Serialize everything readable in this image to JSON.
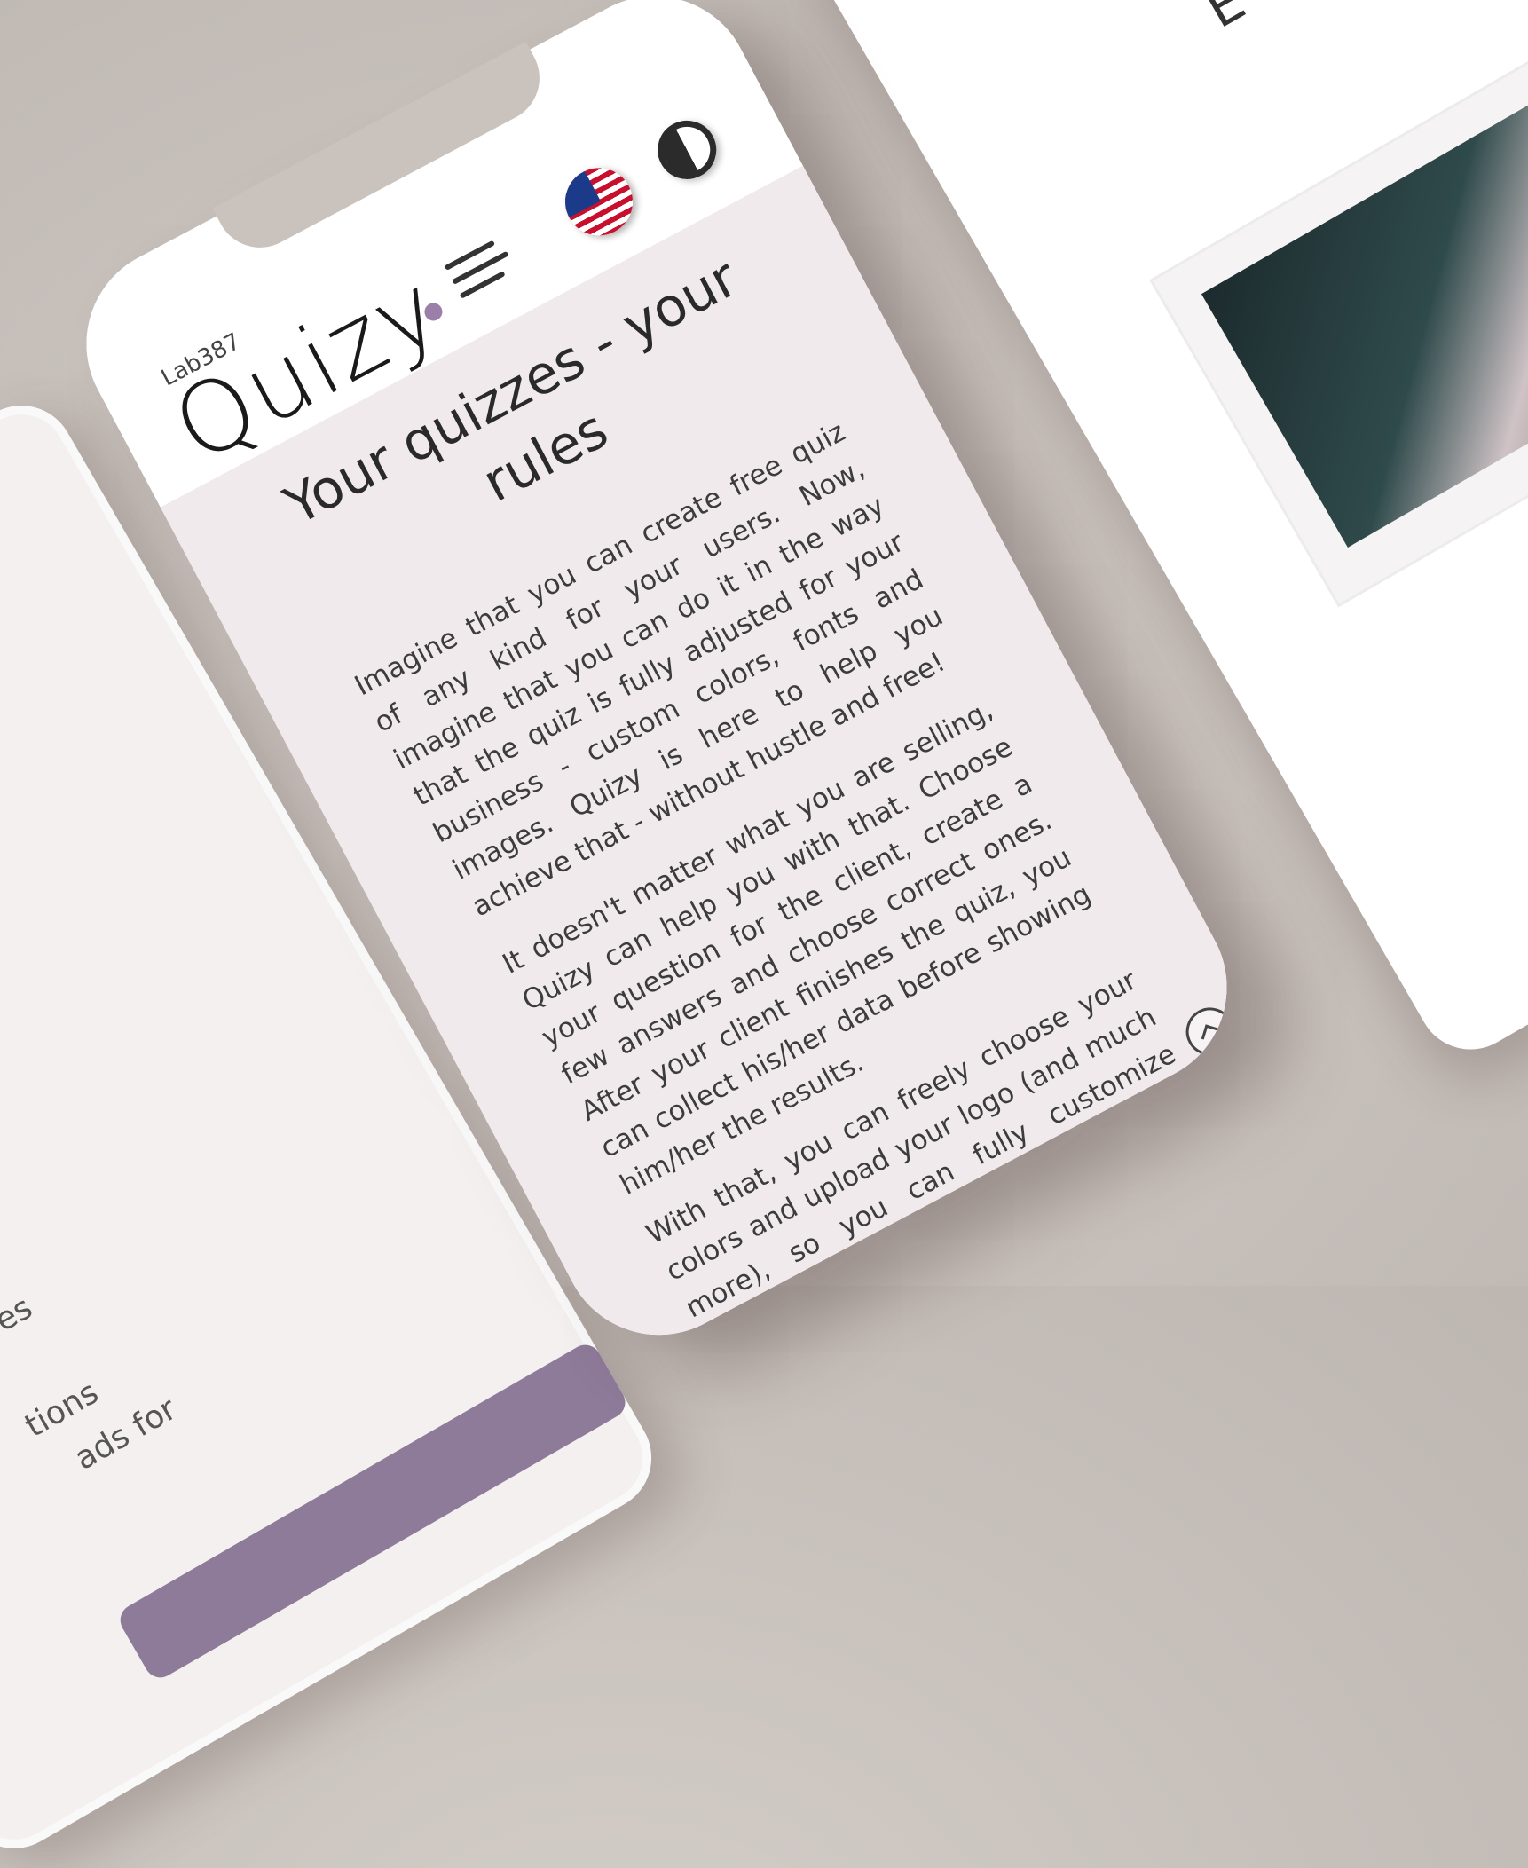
{
  "left_phone": {
    "fragments": [
      "es",
      "tions",
      "ads for"
    ]
  },
  "right_phone": {
    "heading_fragment": "E"
  },
  "header": {
    "brand_small": "Lab387",
    "brand": "Quizy",
    "language": "English (US)",
    "accent_color": "#9b7fa8"
  },
  "main": {
    "title": "Your quizzes - your rules",
    "paragraphs": [
      "Imagine that you can create free quiz of any kind for your users. Now, imagine that you can do it in the way that the quiz is fully adjusted for your business - custom colors, fonts and images. Quizy is here to help you achieve that - without hustle and free!",
      "It doesn't matter what you are selling, Quizy can help you with that. Choose your question for the client, create a few answers and choose correct ones. After your client finishes the quiz, you can collect his/her data before showing him/her the results.",
      "With that, you can freely choose your colors and upload your logo (and much more), so you can fully customize Quizy"
    ],
    "background_color": "#f1eaec"
  }
}
